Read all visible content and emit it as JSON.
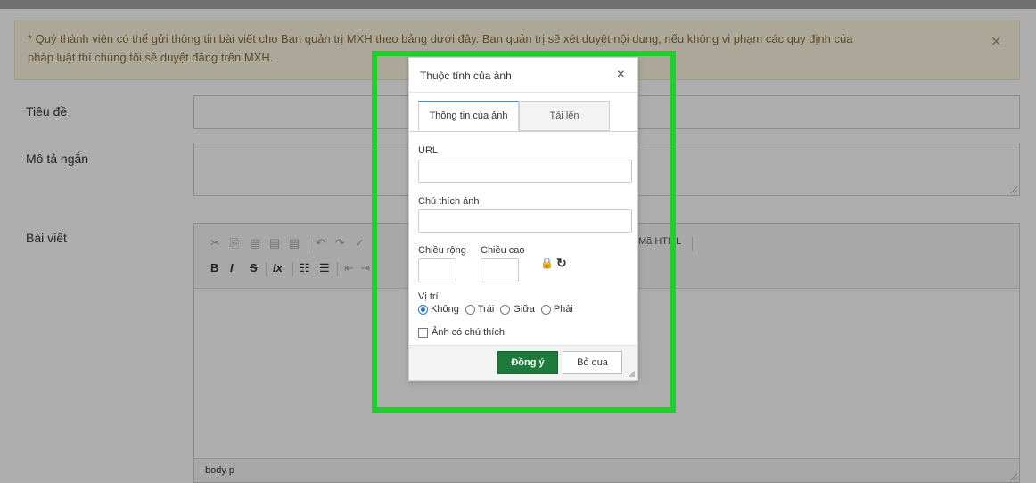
{
  "notice": {
    "line1": "* Quý thành viên có thể gửi thông tin bài viết cho Ban quản trị MXH theo bảng dưới đây. Ban quản trị sẽ xét duyệt nội dung, nếu không vi phạm các quy định của",
    "line2": "pháp luật thì chúng tôi sẽ duyệt đăng trên MXH.",
    "close": "×"
  },
  "form": {
    "title_label": "Tiêu đề",
    "summary_label": "Mô tả ngắn",
    "article_label": "Bài viết"
  },
  "editor": {
    "source_label": "Mã HTML",
    "toolbar_row2": [
      "B",
      "I",
      "S",
      "Ix"
    ],
    "status_path": "body  p"
  },
  "dialog": {
    "title": "Thuộc tính của ảnh",
    "close": "×",
    "tabs": [
      "Thông tin của ảnh",
      "Tải lên"
    ],
    "url_label": "URL",
    "url_value": "",
    "caption_label": "Chú thích ảnh",
    "caption_value": "",
    "width_label": "Chiều rộng",
    "height_label": "Chiều cao",
    "position_label": "Vị trí",
    "position_options": [
      "Không",
      "Trái",
      "Giữa",
      "Phải"
    ],
    "selected_position": "Không",
    "captioned_label": "Ảnh có chú thích",
    "ok_label": "Đồng ý",
    "cancel_label": "Bỏ qua"
  },
  "colors": {
    "highlight": "#1fd02c",
    "ok_button": "#1d7a3c",
    "notice_bg": "#fcf8e3"
  }
}
